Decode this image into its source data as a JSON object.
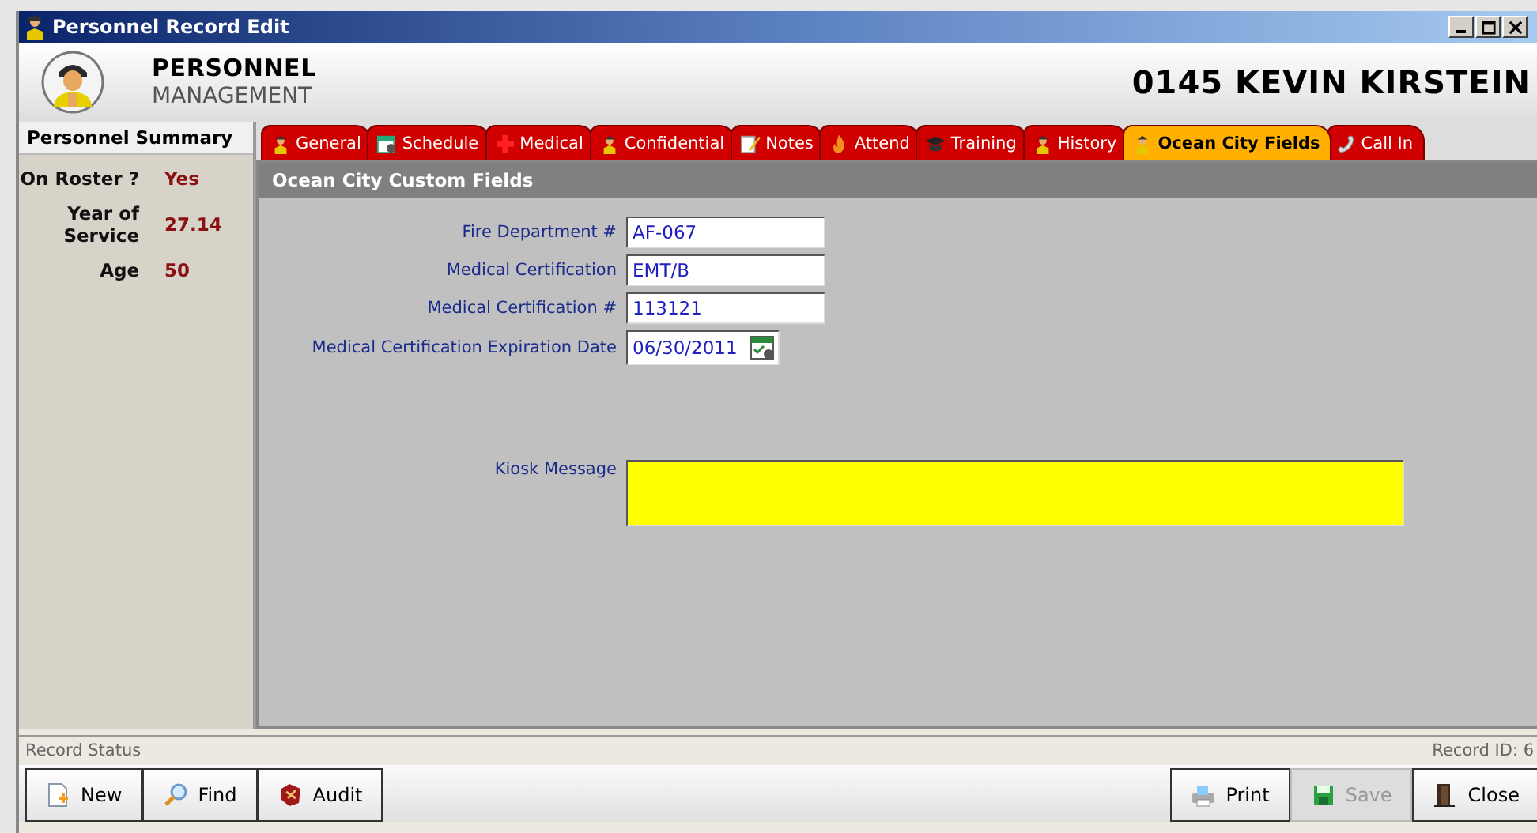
{
  "window": {
    "title": "Personnel Record Edit"
  },
  "header": {
    "app_name_line1": "PERSONNEL",
    "app_name_line2": "MANAGEMENT",
    "record_title": "0145  KEVIN KIRSTEIN"
  },
  "summary": {
    "title": "Personnel Summary",
    "items": [
      {
        "label": "On Roster ?",
        "value": "Yes"
      },
      {
        "label": "Year of Service",
        "value": "27.14"
      },
      {
        "label": "Age",
        "value": "50"
      }
    ]
  },
  "tabs": [
    {
      "label": "General",
      "selected": false
    },
    {
      "label": "Schedule",
      "selected": false
    },
    {
      "label": "Medical",
      "selected": false
    },
    {
      "label": "Confidential",
      "selected": false
    },
    {
      "label": "Notes",
      "selected": false
    },
    {
      "label": "Attend",
      "selected": false
    },
    {
      "label": "Training",
      "selected": false
    },
    {
      "label": "History",
      "selected": false
    },
    {
      "label": "Ocean City Fields",
      "selected": true
    },
    {
      "label": "Call In",
      "selected": false
    }
  ],
  "panel": {
    "title": "Ocean City Custom Fields",
    "fields": [
      {
        "label": "Fire Department #",
        "value": "AF-067",
        "kind": "text"
      },
      {
        "label": "Medical Certification",
        "value": "EMT/B",
        "kind": "text"
      },
      {
        "label": "Medical Certification #",
        "value": "113121",
        "kind": "text"
      },
      {
        "label": "Medical Certification Expiration Date",
        "value": "06/30/2011",
        "kind": "date"
      }
    ],
    "kiosk_label": "Kiosk Message"
  },
  "status_bar": {
    "left": "Record Status",
    "right": "Record ID: 6"
  },
  "buttons_left": [
    {
      "label": "New",
      "disabled": false
    },
    {
      "label": "Find",
      "disabled": false
    },
    {
      "label": "Audit",
      "disabled": false
    }
  ],
  "buttons_right": [
    {
      "label": "Print",
      "disabled": false
    },
    {
      "label": "Save",
      "disabled": true
    },
    {
      "label": "Close",
      "disabled": false
    }
  ]
}
